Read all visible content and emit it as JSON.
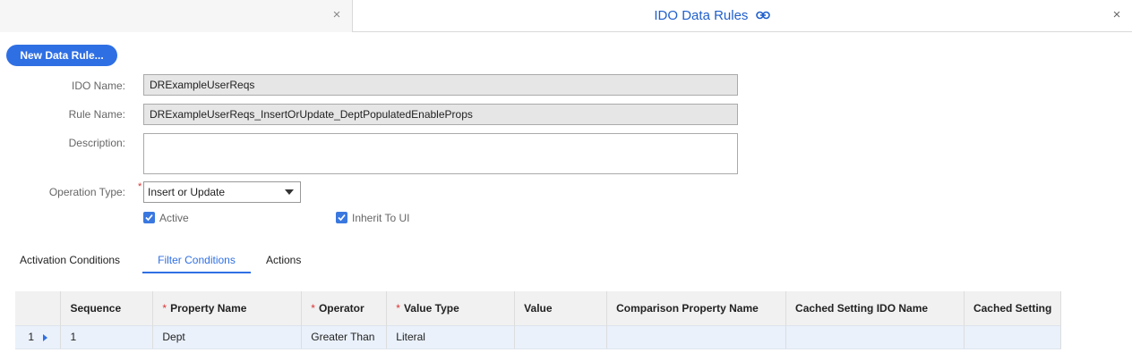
{
  "tabs": {
    "left_close": "×",
    "active_title": "IDO Data Rules",
    "right_close": "×"
  },
  "toolbar": {
    "new_rule_label": "New Data Rule..."
  },
  "form": {
    "ido_name_label": "IDO Name:",
    "ido_name_value": "DRExampleUserReqs",
    "rule_name_label": "Rule Name:",
    "rule_name_value": "DRExampleUserReqs_InsertOrUpdate_DeptPopulatedEnableProps",
    "description_label": "Description:",
    "description_value": "",
    "operation_type_label": "Operation Type:",
    "operation_type_value": "Insert or Update",
    "required_marker": "*",
    "active_label": "Active",
    "inherit_label": "Inherit To UI"
  },
  "subtabs": [
    "Activation Conditions",
    "Filter Conditions",
    "Actions"
  ],
  "grid": {
    "required_marker": "*",
    "columns": [
      "Sequence",
      "Property Name",
      "Operator",
      "Value Type",
      "Value",
      "Comparison Property Name",
      "Cached Setting IDO Name",
      "Cached Setting"
    ],
    "rows": [
      {
        "row_number": "1",
        "sequence": "1",
        "property_name": "Dept",
        "operator": "Greater Than",
        "value_type": "Literal",
        "value": "",
        "comparison_property_name": "",
        "cached_setting_ido_name": "",
        "cached_setting": ""
      }
    ]
  },
  "colors": {
    "accent": "#2f6fe4",
    "title": "#1f5fcc",
    "required": "#d33333"
  }
}
